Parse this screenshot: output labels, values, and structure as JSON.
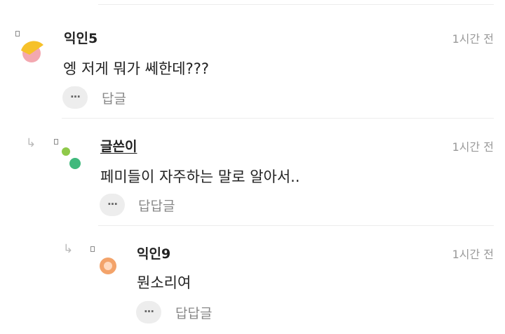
{
  "comments": [
    {
      "name": "익인5",
      "time": "1시간 전",
      "body": "엥 저게 뭐가 쎄한데???",
      "reply_label": "답글",
      "more_label": "···",
      "avatar_icon": "yellow-pink-blob-avatar",
      "depth": 0
    },
    {
      "name": "글쓴이",
      "time": "1시간 전",
      "body": "페미들이 자주하는 말로 알아서..",
      "reply_label": "답답글",
      "more_label": "···",
      "avatar_icon": "green-dots-avatar",
      "is_author": true,
      "depth": 1
    },
    {
      "name": "익인9",
      "time": "1시간 전",
      "body": "뭔소리여",
      "reply_label": "답답글",
      "more_label": "···",
      "avatar_icon": "orange-circle-avatar",
      "depth": 2
    }
  ],
  "colors": {
    "reply_arrow": "#b9b9b9",
    "time": "#999999",
    "button_bg": "#ededed",
    "avatar_yellow": "#f6c12a",
    "avatar_pink": "#f3a8b0",
    "avatar_green_light": "#8fc94a",
    "avatar_green": "#3fb97c",
    "avatar_orange": "#f3a36a"
  }
}
